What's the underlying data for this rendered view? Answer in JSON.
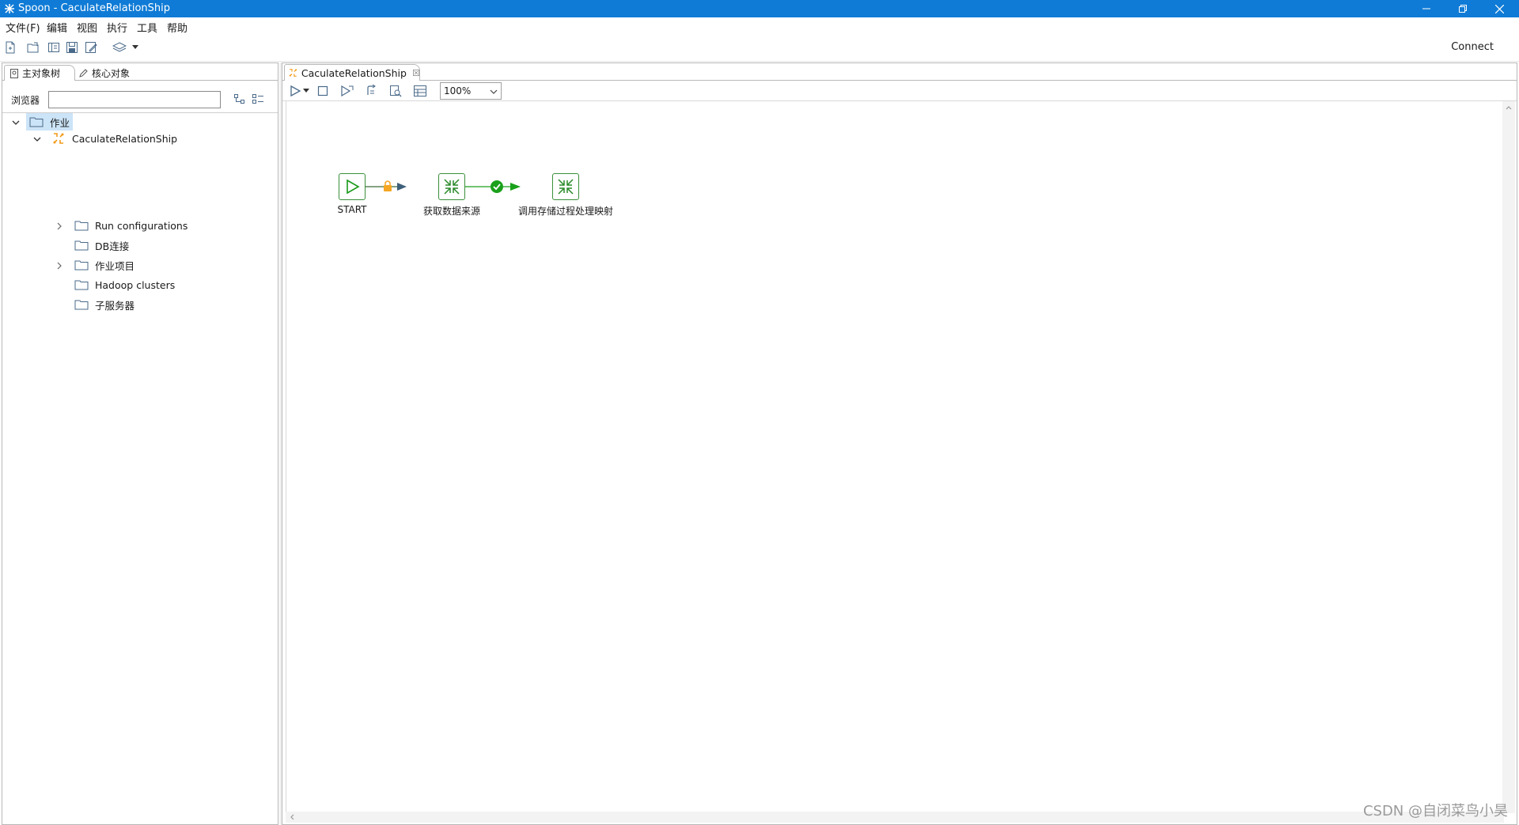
{
  "window": {
    "title": "Spoon - CaculateRelationShip",
    "controls": [
      "minimize-icon",
      "restore-icon",
      "close-icon"
    ]
  },
  "menu": [
    "文件(F)",
    "编辑",
    "视图",
    "执行",
    "工具",
    "帮助"
  ],
  "toolbar": {
    "icons": [
      "new-file-icon",
      "open-file-icon",
      "explore-repository-icon",
      "save-icon",
      "save-as-icon",
      "layers-icon",
      "dropdown-icon"
    ],
    "connect_label": "Connect"
  },
  "left_panel": {
    "tabs": [
      "主对象树",
      "核心对象"
    ],
    "search_label": "浏览器",
    "search_value": "",
    "tree": {
      "root": "作业",
      "job": "CaculateRelationShip",
      "children": [
        "Run configurations",
        "DB连接",
        "作业项目",
        "Hadoop clusters",
        "子服务器"
      ]
    }
  },
  "editor": {
    "tab_label": "CaculateRelationShip",
    "zoom": "100%",
    "toolbar_icons": [
      "run-icon",
      "run-options-icon",
      "stop-icon",
      "preview-icon",
      "replay-icon",
      "check-icon",
      "sql-icon"
    ],
    "nodes": {
      "start": "START",
      "get_source": "获取数据来源",
      "call_proc": "调用存储过程处理映射"
    },
    "hops": [
      {
        "from": "START",
        "to": "获取数据来源",
        "condition": "unconditional",
        "color": "#f5a623"
      },
      {
        "from": "获取数据来源",
        "to": "调用存储过程处理映射",
        "condition": "success",
        "color": "#1aa01a"
      }
    ]
  },
  "watermark": "CSDN @自闭菜鸟小昊",
  "colors": {
    "titlebar": "#0f7bd6",
    "node_border": "#3a8f3a",
    "success": "#1aa01a",
    "lock": "#f5a623"
  }
}
